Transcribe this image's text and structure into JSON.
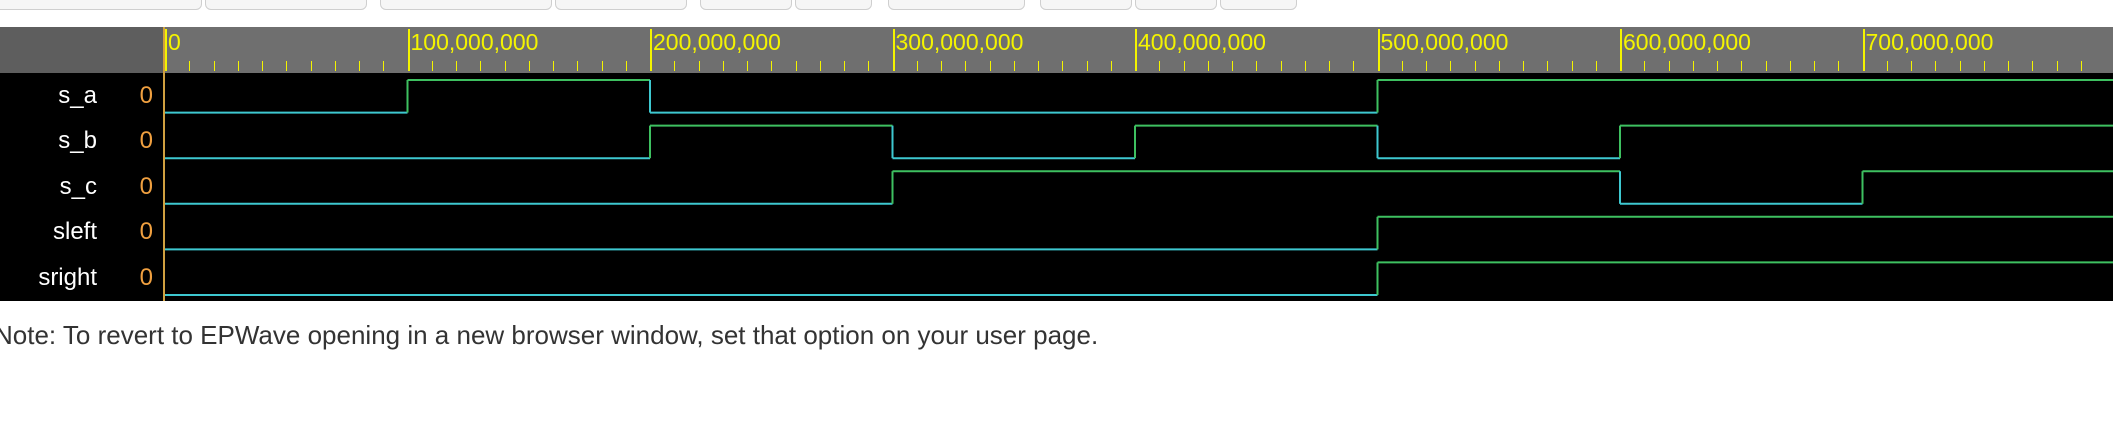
{
  "timeline": {
    "labels": [
      "0",
      "100,000,000",
      "200,000,000",
      "300,000,000",
      "400,000,000",
      "500,000,000",
      "600,000,000",
      "700,000,000"
    ]
  },
  "signals": [
    {
      "name": "s_a",
      "value": "0",
      "transitions": [
        [
          0,
          0
        ],
        [
          100000000,
          1
        ],
        [
          200000000,
          0
        ],
        [
          500000000,
          1
        ]
      ]
    },
    {
      "name": "s_b",
      "value": "0",
      "transitions": [
        [
          0,
          0
        ],
        [
          200000000,
          1
        ],
        [
          300000000,
          0
        ],
        [
          400000000,
          1
        ],
        [
          500000000,
          0
        ],
        [
          600000000,
          1
        ]
      ]
    },
    {
      "name": "s_c",
      "value": "0",
      "transitions": [
        [
          0,
          0
        ],
        [
          300000000,
          1
        ],
        [
          600000000,
          0
        ],
        [
          700000000,
          1
        ]
      ]
    },
    {
      "name": "sleft",
      "value": "0",
      "transitions": [
        [
          0,
          0
        ],
        [
          500000000,
          1
        ]
      ]
    },
    {
      "name": "sright",
      "value": "0",
      "transitions": [
        [
          0,
          0
        ],
        [
          500000000,
          1
        ]
      ]
    }
  ],
  "colors": {
    "low": "#3ec8d0",
    "high": "#3ec060",
    "axis": "#f4f400",
    "value": "#f0a040"
  },
  "note": "Note: To revert to EPWave opening in a new browser window, set that option on your user page."
}
